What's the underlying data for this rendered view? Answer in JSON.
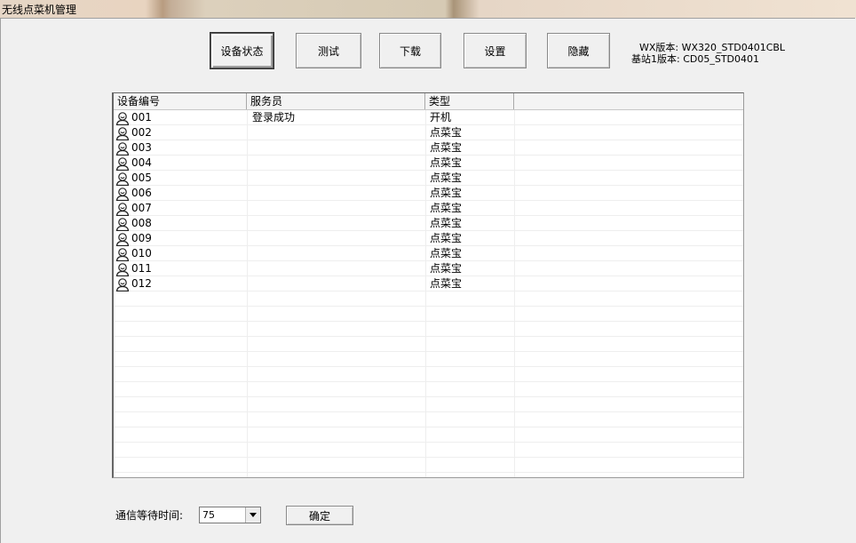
{
  "window": {
    "title": "无线点菜机管理"
  },
  "toolbar": {
    "buttons": [
      {
        "label": "设备状态"
      },
      {
        "label": "测试"
      },
      {
        "label": "下载"
      },
      {
        "label": "设置"
      },
      {
        "label": "隐藏"
      }
    ]
  },
  "versions": {
    "wx": "WX版本: WX320_STD0401CBL",
    "base": "基站1版本: CD05_STD0401"
  },
  "devices": {
    "columns": [
      "设备编号",
      "服务员",
      "类型"
    ],
    "rows": [
      {
        "id": "001",
        "waiter": "登录成功",
        "type": "开机"
      },
      {
        "id": "002",
        "waiter": "",
        "type": "点菜宝"
      },
      {
        "id": "003",
        "waiter": "",
        "type": "点菜宝"
      },
      {
        "id": "004",
        "waiter": "",
        "type": "点菜宝"
      },
      {
        "id": "005",
        "waiter": "",
        "type": "点菜宝"
      },
      {
        "id": "006",
        "waiter": "",
        "type": "点菜宝"
      },
      {
        "id": "007",
        "waiter": "",
        "type": "点菜宝"
      },
      {
        "id": "008",
        "waiter": "",
        "type": "点菜宝"
      },
      {
        "id": "009",
        "waiter": "",
        "type": "点菜宝"
      },
      {
        "id": "010",
        "waiter": "",
        "type": "点菜宝"
      },
      {
        "id": "011",
        "waiter": "",
        "type": "点菜宝"
      },
      {
        "id": "012",
        "waiter": "",
        "type": "点菜宝"
      }
    ]
  },
  "footer": {
    "timeout_label": "通信等待时间:",
    "timeout_value": "75",
    "ok_label": "确定"
  }
}
